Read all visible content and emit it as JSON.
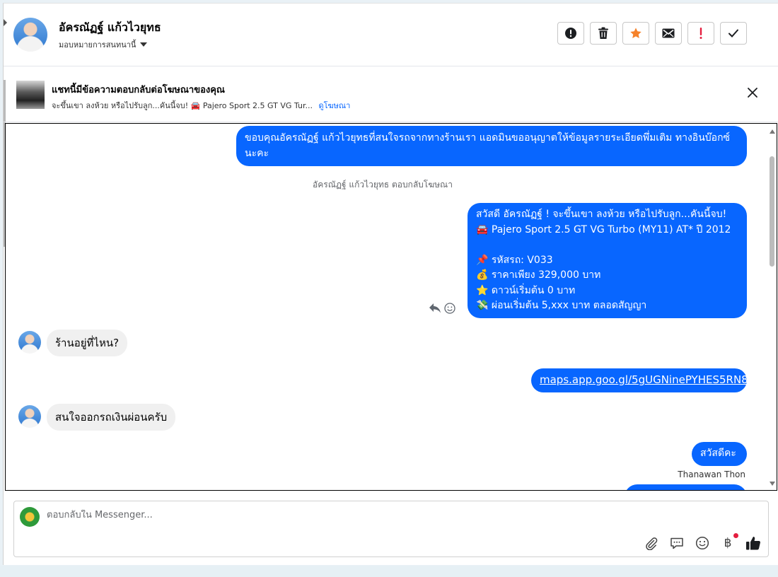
{
  "contact": {
    "name": "อัครณัฏฐ์ แก้วไวยุทธ",
    "assign_label": "มอบหมายการสนทนานี้"
  },
  "header_actions": [
    {
      "name": "spam-button",
      "icon": "alert-circle-icon"
    },
    {
      "name": "delete-button",
      "icon": "trash-icon"
    },
    {
      "name": "star-button",
      "icon": "star-icon",
      "color": "#f5822a"
    },
    {
      "name": "mark-unread-button",
      "icon": "envelope-icon"
    },
    {
      "name": "follow-up-button",
      "icon": "exclamation-icon",
      "color": "#e41e3f"
    },
    {
      "name": "mark-done-button",
      "icon": "check-icon"
    }
  ],
  "ad_banner": {
    "title": "แชทนี้มีข้อความตอบกลับต่อโฆษณาของคุณ",
    "subtitle": "จะขึ้นเขา ลงห้วย หรือไปรับลูก...คันนี้จบ! 🚘 Pajero Sport 2.5 GT VG Tur...",
    "link": "ดูโฆษณา"
  },
  "messages": [
    {
      "id": "m1",
      "dir": "out",
      "text": "ขอบคุณอัครณัฏฐ์ แก้วไวยุทธที่สนใจรถจากทางร้านเรา แอดมินขออนุญาตให้ข้อมูลรายระเอียดพึ่มเติม ทางอินบ๊อกซ์นะคะ"
    },
    {
      "id": "note",
      "dir": "system",
      "text": "อัครณัฏฐ์ แก้วไวยุทธ ตอบกลับโฆษณา"
    },
    {
      "id": "m2",
      "dir": "out",
      "text": "สวัสดี อัครณัฏฐ์ ! จะขึ้นเขา ลงห้วย หรือไปรับลูก...คันนี้จบ!\n🚘 Pajero Sport 2.5 GT VG Turbo (MY11) AT* ปี 2012\n\n📌 รหัสรถ: V033\n💰 ราคาเพียง 329,000 บาท\n⭐ ดาวน์เริ่มต้น 0 บาท\n💸 ผ่อนเริ่มต้น 5,xxx บาท ตลอดสัญญา"
    },
    {
      "id": "m3",
      "dir": "in",
      "text": "ร้านอยู่ที่ไหน?"
    },
    {
      "id": "m4",
      "dir": "out",
      "text": "maps.app.goo.gl/5gUGNinePYHES5RN8",
      "is_link": true
    },
    {
      "id": "m5",
      "dir": "in",
      "text": "สนใจออกรถเงินผ่อนครับ"
    },
    {
      "id": "m6",
      "dir": "out",
      "text": "สวัสดีคะ",
      "sender": "Thanawan Thon"
    }
  ],
  "composer": {
    "placeholder": "ตอบกลับใน Messenger...",
    "value": "",
    "tools": [
      "paperclip-icon",
      "saved-reply-icon",
      "emoji-icon",
      "baht-icon",
      "like-icon"
    ],
    "baht_symbol": "฿"
  }
}
